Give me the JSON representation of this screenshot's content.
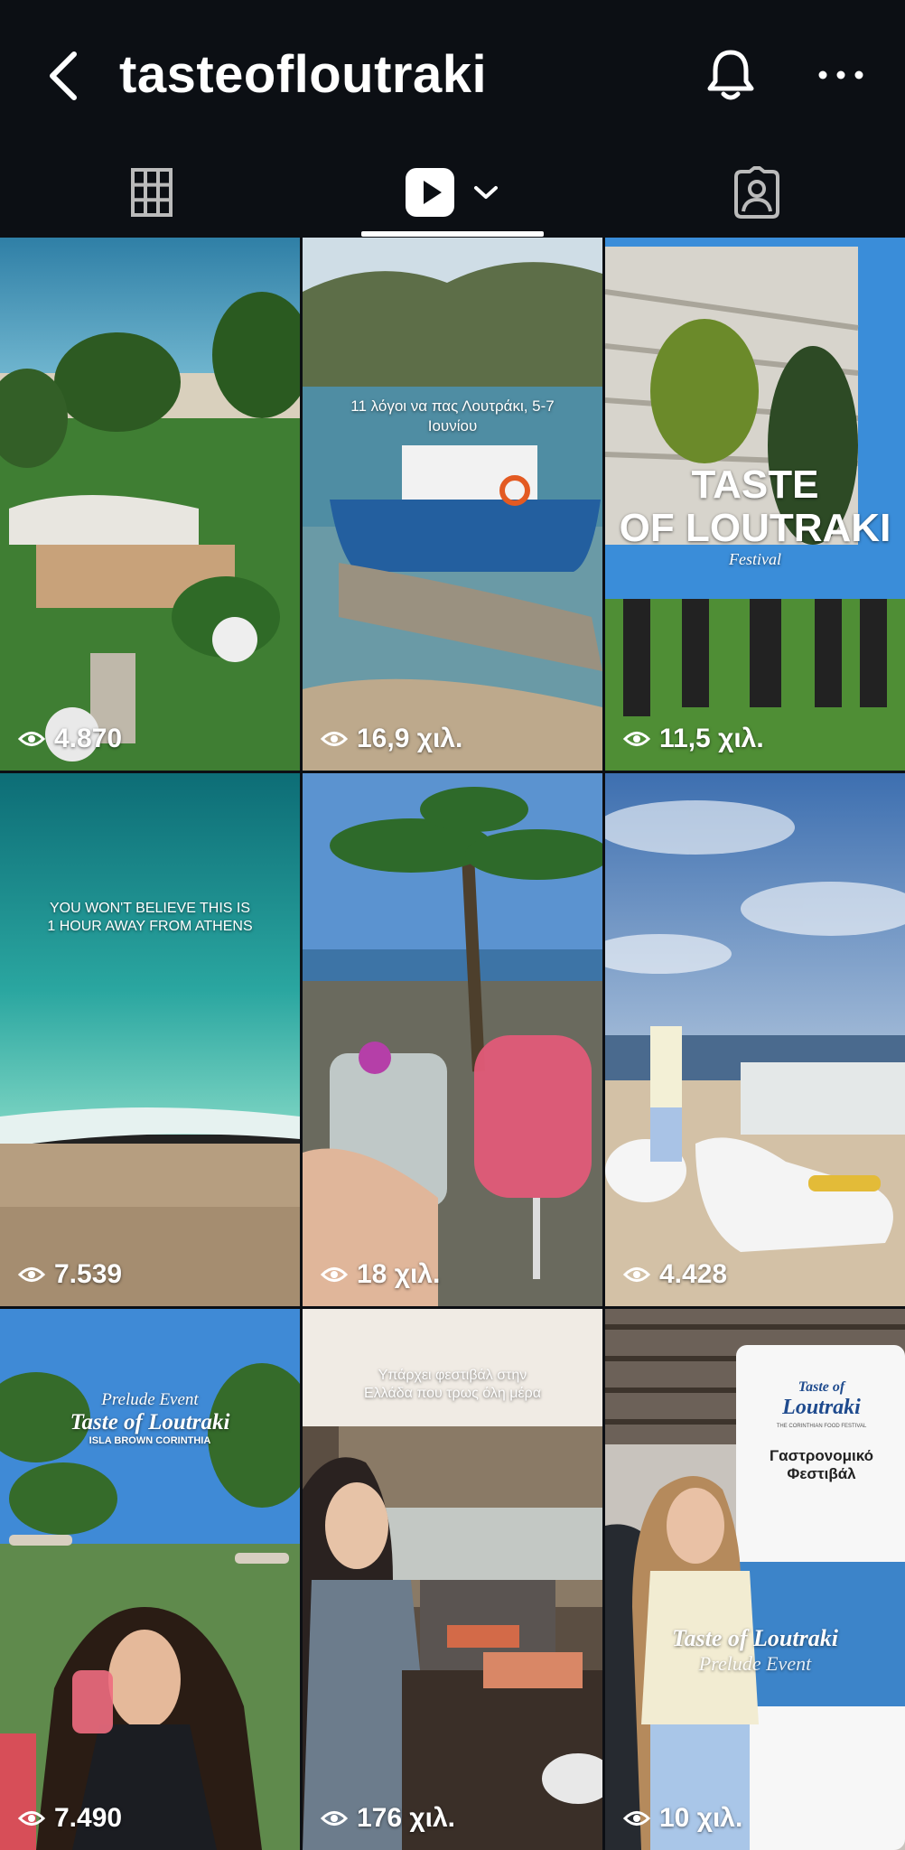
{
  "header": {
    "username": "tasteofloutraki"
  },
  "icons": {
    "back": "back-chevron-icon",
    "bell": "bell-icon",
    "more": "more-dots-icon",
    "grid": "grid-icon",
    "reels": "reels-play-icon",
    "reels_dropdown": "chevron-down-icon",
    "tagged": "tagged-person-icon",
    "views": "eye-icon"
  },
  "tabs": [
    {
      "id": "grid",
      "active": false
    },
    {
      "id": "reels",
      "active": true
    },
    {
      "id": "tagged",
      "active": false
    }
  ],
  "reels": [
    {
      "views": "4.870",
      "overlay": ""
    },
    {
      "views": "16,9 χιλ.",
      "overlay": "11 λόγοι να πας Λουτράκι, 5-7 Ιουνίου"
    },
    {
      "views": "11,5 χιλ.",
      "overlay_line1": "TASTE",
      "overlay_line2": "OF LOUTRAKI",
      "overlay_line3": "Festival"
    },
    {
      "views": "7.539",
      "overlay_line1": "YOU WON'T BELIEVE THIS IS",
      "overlay_line2": "1 HOUR AWAY FROM ATHENS"
    },
    {
      "views": "18 χιλ.",
      "overlay": ""
    },
    {
      "views": "4.428",
      "overlay": ""
    },
    {
      "views": "7.490",
      "overlay_line1": "Prelude Event",
      "overlay_line2": "Taste of Loutraki",
      "overlay_line3": "ISLA BROWN CORINTHIA"
    },
    {
      "views": "176 χιλ.",
      "overlay_line1": "Υπάρχει φεστιβάλ στην",
      "overlay_line2": "Ελλάδα που τρως όλη μέρα"
    },
    {
      "views": "10 χιλ.",
      "banner_line1": "Taste of",
      "banner_line2": "Loutraki",
      "banner_sub": "THE CORINTHIAN FOOD FESTIVAL",
      "banner_title1": "Γαστρονομικό",
      "banner_title2": "Φεστιβάλ",
      "overlay_line1": "Taste of Loutraki",
      "overlay_line2": "Prelude Event"
    }
  ],
  "colors": {
    "background": "#0c0f14",
    "text": "#ffffff"
  }
}
